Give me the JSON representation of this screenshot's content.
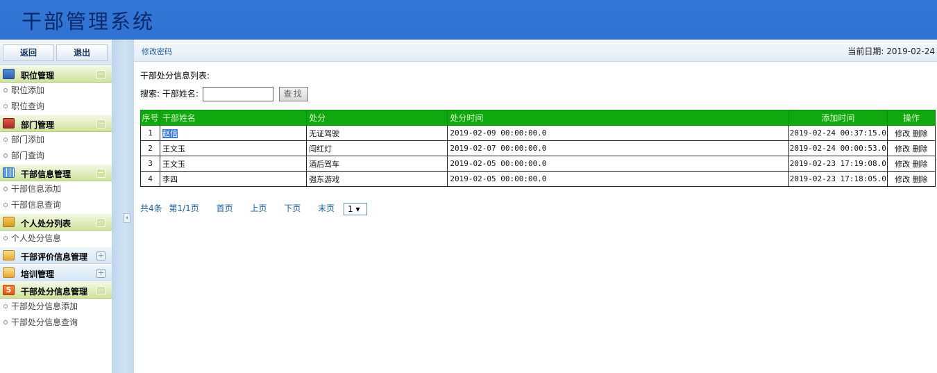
{
  "app_title": "干部管理系统",
  "sidebar": {
    "back_label": "返回",
    "exit_label": "退出",
    "sections": [
      {
        "label": "职位管理",
        "expanded": true,
        "items": [
          "职位添加",
          "职位查询"
        ]
      },
      {
        "label": "部门管理",
        "expanded": true,
        "items": [
          "部门添加",
          "部门查询"
        ]
      },
      {
        "label": "干部信息管理",
        "expanded": true,
        "items": [
          "干部信息添加",
          "干部信息查询"
        ]
      },
      {
        "label": "个人处分列表",
        "expanded": true,
        "items": [
          "个人处分信息"
        ]
      },
      {
        "label": "干部评价信息管理",
        "expanded": false,
        "items": []
      },
      {
        "label": "培训管理",
        "expanded": false,
        "items": []
      },
      {
        "label": "干部处分信息管理",
        "expanded": true,
        "items": [
          "干部处分信息添加",
          "干部处分信息查询"
        ]
      }
    ]
  },
  "topbar": {
    "change_password": "修改密码",
    "date_label": "当前日期:",
    "date_value": "2019-02-24"
  },
  "main": {
    "caption": "干部处分信息列表:",
    "search_label": "搜索:",
    "search_field_label": "干部姓名:",
    "search_value": "",
    "search_button": "查找"
  },
  "table": {
    "columns": [
      "序号",
      "干部姓名",
      "处分",
      "处分时间",
      "添加时间",
      "操作"
    ],
    "rows": [
      {
        "no": "1",
        "name": "赵信",
        "punishment": "无证驾驶",
        "punish_time": "2019-02-09 00:00:00.0",
        "add_time": "2019-02-24 00:37:15.0"
      },
      {
        "no": "2",
        "name": "王文玉",
        "punishment": "闯红灯",
        "punish_time": "2019-02-07 00:00:00.0",
        "add_time": "2019-02-24 00:00:53.0"
      },
      {
        "no": "3",
        "name": "王文玉",
        "punishment": "酒后驾车",
        "punish_time": "2019-02-05 00:00:00.0",
        "add_time": "2019-02-23 17:19:08.0"
      },
      {
        "no": "4",
        "name": "李四",
        "punishment": "强东游戏",
        "punish_time": "2019-02-05 00:00:00.0",
        "add_time": "2019-02-23 17:18:05.0"
      }
    ],
    "edit_label": "修改",
    "delete_label": "删除"
  },
  "pager": {
    "total": "共4条",
    "page_info": "第1/1页",
    "first": "首页",
    "prev": "上页",
    "next": "下页",
    "last": "末页",
    "page_select": "1 ▾"
  },
  "colors": {
    "header_bg": "#3176d6",
    "title_color": "#0b2a6a",
    "table_header_bg": "#10a80f",
    "link_color": "#1b5fa6"
  }
}
